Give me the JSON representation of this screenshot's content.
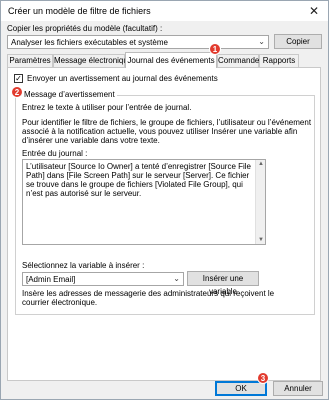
{
  "window": {
    "title": "Créer un modèle de filtre de fichiers"
  },
  "copy_props": {
    "label": "Copier les propriétés du modèle (facultatif) :",
    "selected": "Analyser les fichiers exécutables et système",
    "copy_button": "Copier"
  },
  "tabs": [
    {
      "label": "Paramètres"
    },
    {
      "label": "Message électronique"
    },
    {
      "label": "Journal des événements"
    },
    {
      "label": "Commande"
    },
    {
      "label": "Rapports"
    }
  ],
  "event_log": {
    "checkbox_label": "Envoyer un avertissement au journal des événements",
    "checkbox_checked": true,
    "group_title": "Message d’avertissement",
    "instruction_line1": "Entrez le texte à utiliser pour l’entrée de journal.",
    "instruction_para1": "Pour identifier le filtre de fichiers, le groupe de fichiers, l’utilisateur ou l’événement",
    "instruction_para2": "associé à la notification actuelle, vous pouvez utiliser Insérer une variable afin",
    "instruction_para3": "d’insérer une variable dans votre texte.",
    "entry_label": "Entrée du journal :",
    "entry_text": "L’utilisateur [Source Io Owner] a tenté d’enregistrer [Source File Path] dans [File Screen Path] sur le serveur [Server]. Ce fichier se trouve dans le groupe de fichiers [Violated File Group], qui n’est pas autorisé sur le serveur.",
    "variable_label": "Sélectionnez la variable à insérer :",
    "variable_selected": "[Admin Email]",
    "insert_button": "Insérer une variable",
    "variable_desc_line1": "Insère les adresses de messagerie des administrateurs qui reçoivent le",
    "variable_desc_line2": "courrier électronique."
  },
  "footer": {
    "ok_label": "OK",
    "cancel_label": "Annuler"
  },
  "callouts": [
    "1",
    "2",
    "3"
  ],
  "colors": {
    "callout": "#e23b2e",
    "default_button_border": "#0078d7"
  },
  "icons": {
    "close": "close-icon",
    "dropdown": "chevron-down-icon"
  }
}
